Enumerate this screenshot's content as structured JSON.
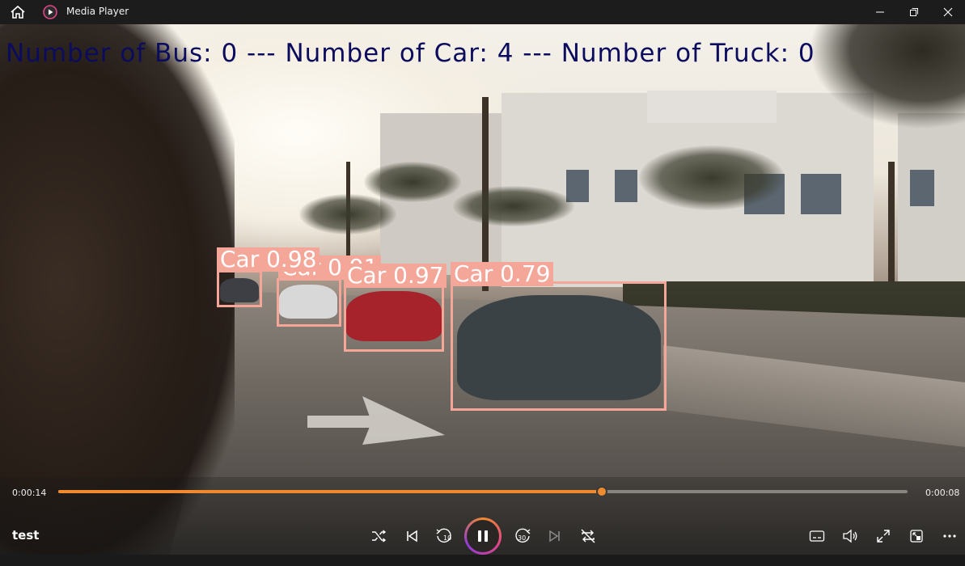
{
  "window": {
    "title": "Media Player",
    "home_icon": "home-icon",
    "app_icon": "media-player-icon",
    "controls": [
      "minimize-icon",
      "maximize-icon",
      "close-icon"
    ]
  },
  "video": {
    "overlay_text": "Number of Bus: 0 --- Number of Car: 4 --- Number of Truck: 0",
    "detections": [
      {
        "label": "Car 0.98"
      },
      {
        "label": "Car 0.91"
      },
      {
        "label": "Car 0.97"
      },
      {
        "label": "Car 0.79"
      }
    ],
    "box_color": "#f4a698",
    "overlay_color": "#0b0c5e"
  },
  "playback": {
    "elapsed": "0:00:14",
    "remaining": "0:00:08",
    "progress": 0.64,
    "media_title": "test",
    "accent_color": "#f08a2e"
  },
  "controls": {
    "shuffle": "shuffle-icon",
    "previous": "previous-icon",
    "rewind": "rewind-10-icon",
    "rewind_label": "10",
    "play_pause": "pause-icon",
    "forward": "forward-30-icon",
    "forward_label": "30",
    "next": "next-icon",
    "repeat": "repeat-off-icon",
    "captions": "captions-icon",
    "volume": "volume-icon",
    "fullscreen": "fullscreen-icon",
    "miniplayer": "miniplayer-icon",
    "more": "more-icon"
  }
}
